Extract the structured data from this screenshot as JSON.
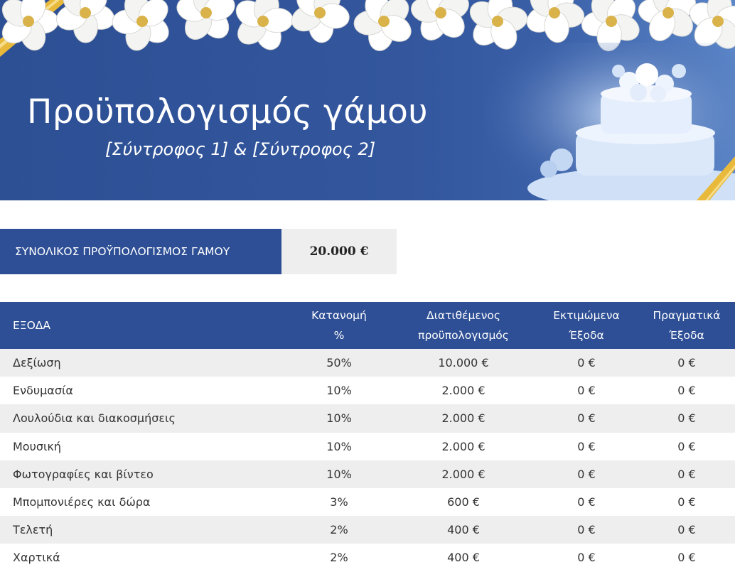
{
  "header": {
    "title": "Προϋπολογισμός γάμου",
    "subtitle": "[Σύντροφος 1] & [Σύντροφος 2]"
  },
  "total": {
    "label": "ΣΥΝΟΛΙΚΟΣ ΠΡΟΫΠΟΛΟΓΙΣΜΟΣ ΓΑΜΟΥ",
    "value": "20.000 €"
  },
  "table": {
    "columns": [
      [
        "ΕΞΟΔΑ"
      ],
      [
        "Κατανομή",
        "%"
      ],
      [
        "Διατιθέμενος",
        "προϋπολογισμός"
      ],
      [
        "Εκτιμώμενα",
        "Έξοδα"
      ],
      [
        "Πραγματικά",
        "Έξοδα"
      ]
    ],
    "rows": [
      [
        "Δεξίωση",
        "50%",
        "10.000 €",
        "0 €",
        "0 €"
      ],
      [
        "Ενδυμασία",
        "10%",
        "2.000 €",
        "0 €",
        "0 €"
      ],
      [
        "Λουλούδια και διακοσμήσεις",
        "10%",
        "2.000 €",
        "0 €",
        "0 €"
      ],
      [
        "Μουσική",
        "10%",
        "2.000 €",
        "0 €",
        "0 €"
      ],
      [
        "Φωτογραφίες και βίντεο",
        "10%",
        "2.000 €",
        "0 €",
        "0 €"
      ],
      [
        "Μπομπονιέρες και δώρα",
        "3%",
        "600 €",
        "0 €",
        "0 €"
      ],
      [
        "Τελετή",
        "2%",
        "400 €",
        "0 €",
        "0 €"
      ],
      [
        "Χαρτικά",
        "2%",
        "400 €",
        "0 €",
        "0 €"
      ]
    ]
  },
  "colors": {
    "brand_blue": "#2e4f95",
    "row_alt": "#eeeeee",
    "ribbon_gold": "#e8b93a"
  }
}
